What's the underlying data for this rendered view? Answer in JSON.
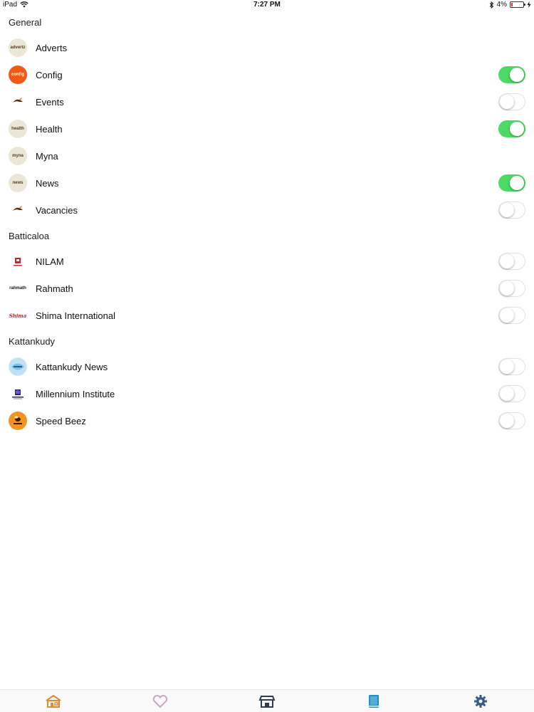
{
  "status_bar": {
    "device": "iPad",
    "time": "7:27 PM",
    "battery": "4%"
  },
  "colors": {
    "switch_on": "#4cd964",
    "home_tab": "#e0893a",
    "heart_tab": "#c9a6c6",
    "store_tab": "#2f3b55",
    "book_tab": "#1e90c8",
    "settings_tab": "#3a5c88"
  },
  "sections": [
    {
      "title": "General",
      "items": [
        {
          "label": "Adverts",
          "logo": "advertz",
          "switch": null
        },
        {
          "label": "Config",
          "logo": "config",
          "switch": true
        },
        {
          "label": "Events",
          "logo": "myna",
          "switch": false
        },
        {
          "label": "Health",
          "logo": "health",
          "switch": true
        },
        {
          "label": "Myna",
          "logo": "myna",
          "switch": null
        },
        {
          "label": "News",
          "logo": "news",
          "switch": true
        },
        {
          "label": "Vacancies",
          "logo": "myna",
          "switch": false
        }
      ]
    },
    {
      "title": "Batticaloa",
      "items": [
        {
          "label": "NILAM",
          "logo": "NILAM",
          "switch": false
        },
        {
          "label": "Rahmath",
          "logo": "rahmath",
          "switch": false
        },
        {
          "label": "Shima International",
          "logo": "Shima",
          "switch": false
        }
      ]
    },
    {
      "title": "Kattankudy",
      "items": [
        {
          "label": "Kattankudy News",
          "logo": "kattankudy-news-icon",
          "switch": false
        },
        {
          "label": "Millennium Institute",
          "logo": "millennium-institute-icon",
          "switch": false
        },
        {
          "label": "Speed Beez",
          "logo": "speed-beez-icon",
          "switch": false
        }
      ]
    }
  ],
  "tabbar": {
    "tabs": [
      {
        "icon": "home-icon"
      },
      {
        "icon": "heart-icon"
      },
      {
        "icon": "store-icon"
      },
      {
        "icon": "book-icon"
      },
      {
        "icon": "gear-icon"
      }
    ]
  }
}
